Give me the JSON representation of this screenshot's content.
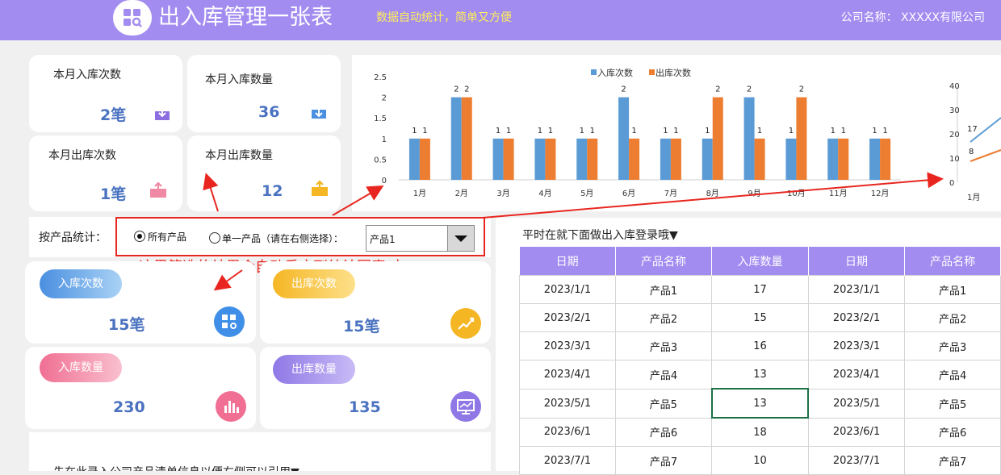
{
  "header": {
    "title": "出入库管理一张表",
    "subtitle": "数据自动统计，简单又方便",
    "company": "公司名称： XXXXX有限公司"
  },
  "monthly_cards": [
    {
      "label": "本月入库次数",
      "value": "2笔"
    },
    {
      "label": "本月入库数量",
      "value": "36"
    },
    {
      "label": "本月出库次数",
      "value": "1笔"
    },
    {
      "label": "本月出库数量",
      "value": "12"
    }
  ],
  "filter": {
    "label": "按产品统计：",
    "option_all": "所有产品",
    "option_single": "单一产品（请在右侧选择）：",
    "selected_product": "产品1",
    "note": "这里筛选的结果会自动反应到统计图表 中"
  },
  "stat_cards": [
    {
      "pill": "入库次数",
      "value": "15笔"
    },
    {
      "pill": "出库次数",
      "value": "15笔"
    },
    {
      "pill": "入库数量",
      "value": "230"
    },
    {
      "pill": "出库数量",
      "value": "135"
    }
  ],
  "bottom_note": "先在此录入公司产品清单信息以便右侧可以引用▼",
  "table": {
    "caption": "平时在就下面做出入库登录哦▼",
    "headers": [
      "日期",
      "产品名称",
      "入库数量",
      "日期",
      "产品名称"
    ],
    "rows": [
      [
        "2023/1/1",
        "产品1",
        "17",
        "2023/1/1",
        "产品1"
      ],
      [
        "2023/2/1",
        "产品2",
        "15",
        "2023/2/1",
        "产品2"
      ],
      [
        "2023/3/1",
        "产品3",
        "16",
        "2023/3/1",
        "产品3"
      ],
      [
        "2023/4/1",
        "产品4",
        "13",
        "2023/4/1",
        "产品4"
      ],
      [
        "2023/5/1",
        "产品5",
        "13",
        "2023/5/1",
        "产品5"
      ],
      [
        "2023/6/1",
        "产品6",
        "18",
        "2023/6/1",
        "产品6"
      ],
      [
        "2023/7/1",
        "产品7",
        "10",
        "2023/7/1",
        "产品7"
      ]
    ]
  },
  "chart_data": [
    {
      "type": "bar",
      "categories": [
        "1月",
        "2月",
        "3月",
        "4月",
        "5月",
        "6月",
        "7月",
        "8月",
        "9月",
        "10月",
        "11月",
        "12月"
      ],
      "series": [
        {
          "name": "入库次数",
          "values": [
            1,
            2,
            1,
            1,
            1,
            2,
            1,
            1,
            2,
            1,
            1,
            1
          ],
          "color": "#5b9bd5"
        },
        {
          "name": "出库次数",
          "values": [
            1,
            2,
            1,
            1,
            1,
            1,
            1,
            2,
            1,
            2,
            1,
            1
          ],
          "color": "#ed7d31"
        }
      ],
      "yticks": [
        "0",
        "0.5",
        "1",
        "1.5",
        "2",
        "2.5"
      ],
      "ylim": [
        0,
        2.5
      ],
      "legend": "top"
    },
    {
      "type": "line",
      "categories": [
        "1月"
      ],
      "yticks": [
        "0",
        "10",
        "20",
        "30",
        "40"
      ],
      "ylim": [
        0,
        40
      ],
      "labels": [
        "17",
        "8"
      ]
    }
  ]
}
